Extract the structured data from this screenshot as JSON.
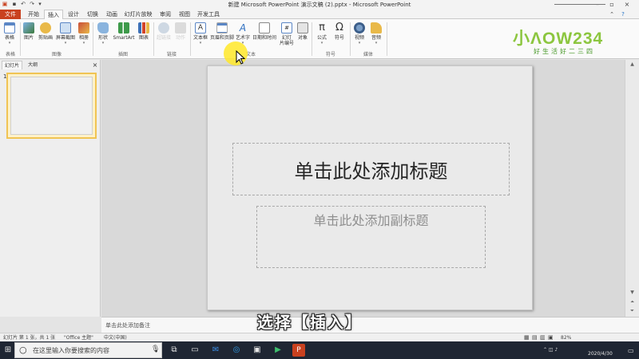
{
  "window": {
    "title": "新建 Microsoft PowerPoint 演示文稿 (2).pptx - Microsoft PowerPoint"
  },
  "ribbon_tabs": [
    {
      "label": "文件"
    },
    {
      "label": "开始"
    },
    {
      "label": "插入"
    },
    {
      "label": "设计"
    },
    {
      "label": "切换"
    },
    {
      "label": "动画"
    },
    {
      "label": "幻灯片放映"
    },
    {
      "label": "审阅"
    },
    {
      "label": "视图"
    },
    {
      "label": "开发工具"
    }
  ],
  "ribbon": {
    "buttons": {
      "table": "表格",
      "picture": "图片",
      "clipart": "剪贴画",
      "screenshot": "屏幕截图",
      "album": "相册",
      "shapes": "形状",
      "smartart": "SmartArt",
      "chart": "图表",
      "hyperlink": "超链接",
      "action": "动作",
      "textbox": "文本框",
      "header_footer": "页眉和页脚",
      "wordart": "艺术字",
      "datetime": "日期和时间",
      "slide_number_line1": "幻灯",
      "slide_number_line2": "片编号",
      "object": "对象",
      "equation": "公式",
      "symbol": "符号",
      "video": "视频",
      "audio": "音频"
    },
    "groups": {
      "tables": "表格",
      "images": "图像",
      "illustrations": "插图",
      "links": "链接",
      "text": "文本",
      "symbols": "符号",
      "media": "媒体"
    }
  },
  "logo": {
    "brand": "小ΛOW234",
    "slogan": "好生活好二三四"
  },
  "left_pane": {
    "tabs": [
      {
        "label": "幻灯片"
      },
      {
        "label": "大纲"
      }
    ],
    "close_glyph": "×",
    "slide_number": "1"
  },
  "slide": {
    "title_placeholder": "单击此处添加标题",
    "subtitle_placeholder": "单击此处添加副标题"
  },
  "notes_placeholder": "单击此处添加备注",
  "caption": "选择【插入】",
  "status_bar": {
    "slide_info": "幻灯片 第 1 张，共 1 张",
    "theme": "\"Office 主题\"",
    "language": "中文(中国)",
    "zoom": "82%"
  },
  "taskbar": {
    "search_placeholder": "在这里输入你要搜索的内容",
    "date": "2020/4/30"
  },
  "colors": {
    "file_tab": "#c9411f",
    "cursor_highlight": "#ffe828",
    "taskbar": "#1f2633",
    "logo_green": "#8cc63f"
  }
}
